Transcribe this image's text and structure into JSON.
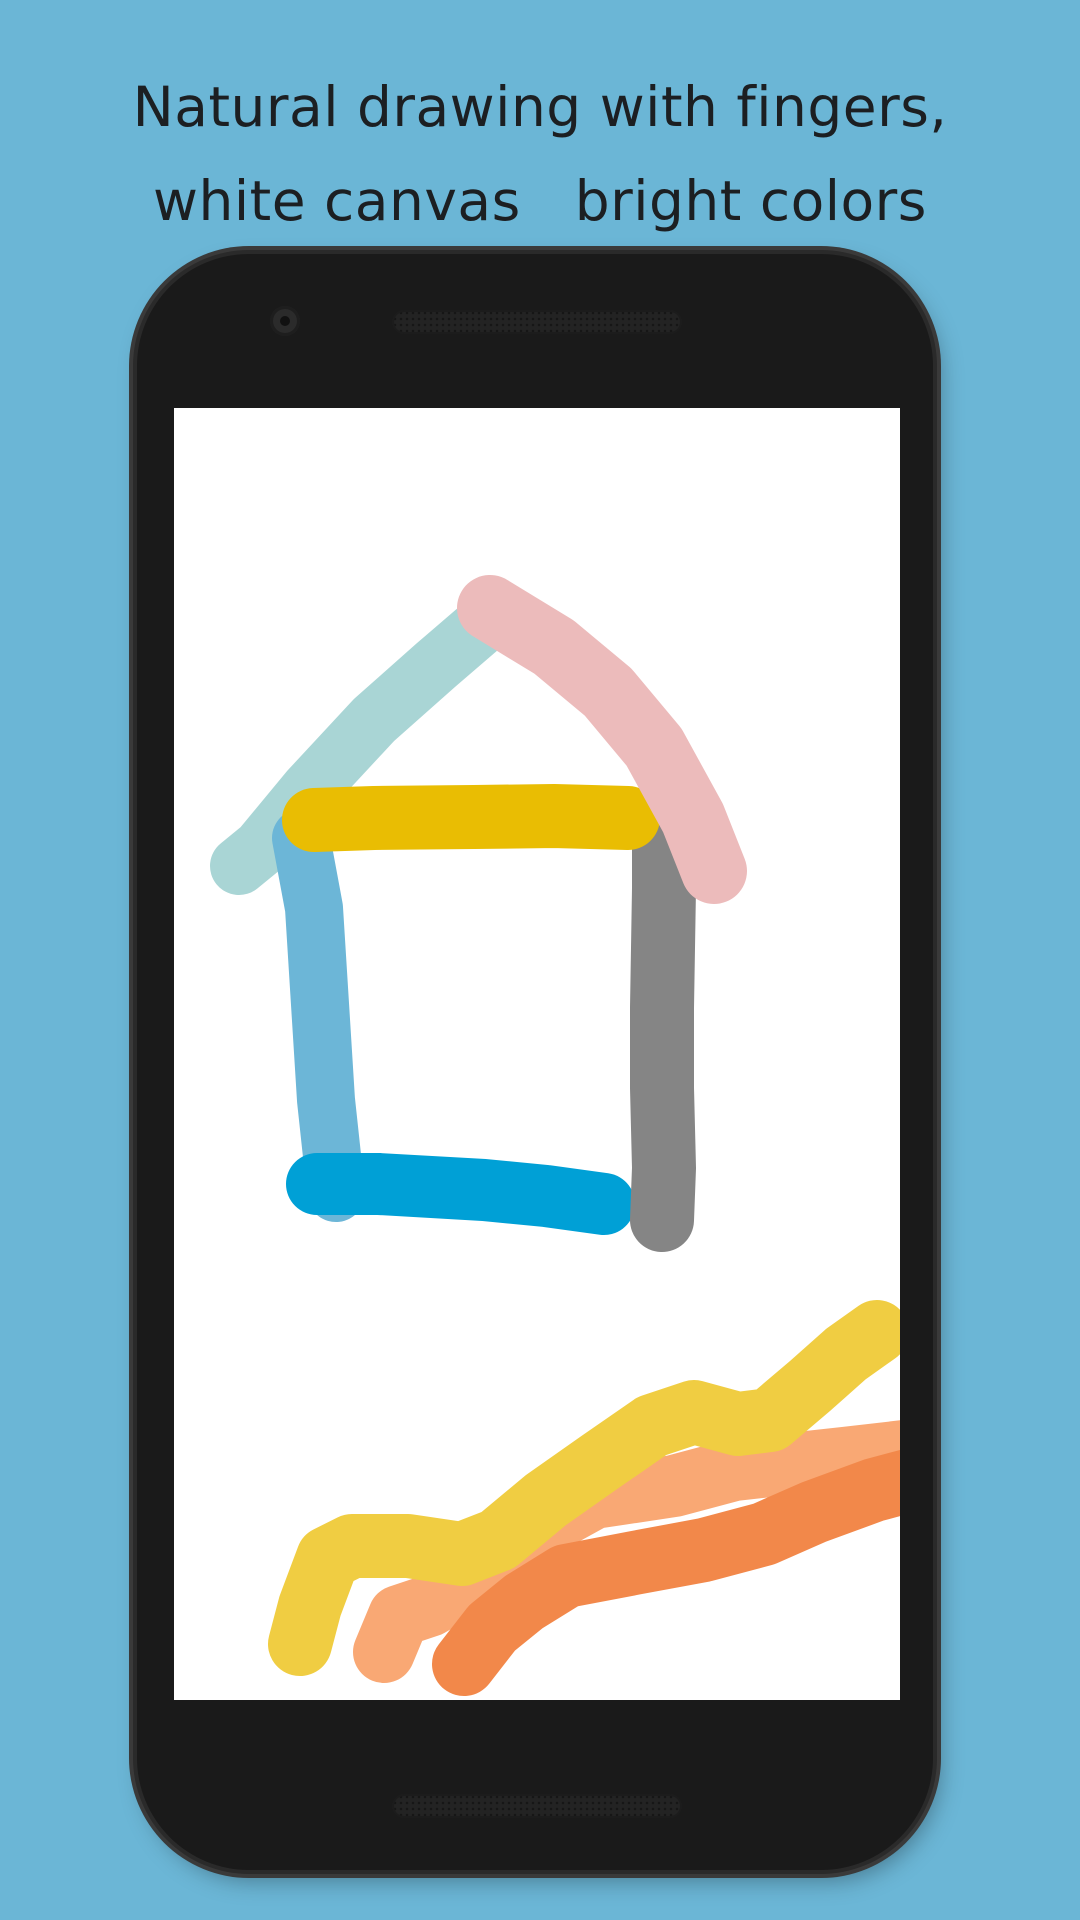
{
  "caption": {
    "line1": "Natural drawing with fingers,",
    "line2": "white canvas   bright colors"
  },
  "device": {
    "front_camera_icon": "camera-icon",
    "earpiece": "speaker-grille",
    "bottom_speaker": "speaker-grille"
  },
  "canvas": {
    "background": "#ffffff",
    "stroke_colors": {
      "mint": "#a9d5d5",
      "pink": "#ecbbbb",
      "yellow": "#e9bd03",
      "sky_blue": "#6cb6d7",
      "gray": "#858585",
      "blue": "#00a0d6",
      "light_yellow": "#f0cd42",
      "peach": "#f9a874",
      "orange": "#f2884a"
    }
  }
}
